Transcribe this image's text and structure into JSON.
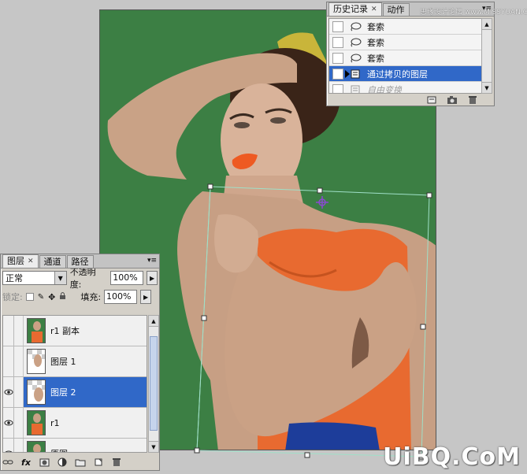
{
  "history_panel": {
    "tabs": [
      {
        "label": "历史记录",
        "active": true
      },
      {
        "label": "动作",
        "active": false
      }
    ],
    "items": [
      {
        "label": "套索",
        "state": "normal"
      },
      {
        "label": "套索",
        "state": "normal"
      },
      {
        "label": "套索",
        "state": "normal"
      },
      {
        "label": "通过拷贝的图层",
        "state": "selected"
      },
      {
        "label": "自由变换",
        "state": "disabled"
      }
    ]
  },
  "layers_panel": {
    "tabs": [
      {
        "label": "图层",
        "active": true
      },
      {
        "label": "通道",
        "active": false
      },
      {
        "label": "路径",
        "active": false
      }
    ],
    "blend_mode": "正常",
    "opacity_label": "不透明度:",
    "opacity_value": "100%",
    "lock_label": "锁定:",
    "fill_label": "填充:",
    "fill_value": "100%",
    "layers": [
      {
        "name": "r1 副本",
        "visible": false,
        "selected": false
      },
      {
        "name": "图层 1",
        "visible": false,
        "selected": false
      },
      {
        "name": "图层 2",
        "visible": true,
        "selected": true
      },
      {
        "name": "r1",
        "visible": true,
        "selected": false
      },
      {
        "name": "原图",
        "visible": true,
        "selected": false
      }
    ]
  },
  "watermark": {
    "main": "UiBQ.CoM",
    "top": "思缘设计论坛 www.MISSYUAN.COM"
  },
  "colors": {
    "canvas_green": "#3c7f44",
    "selection_blue": "#3068c8",
    "dress_orange": "#e86a30"
  }
}
